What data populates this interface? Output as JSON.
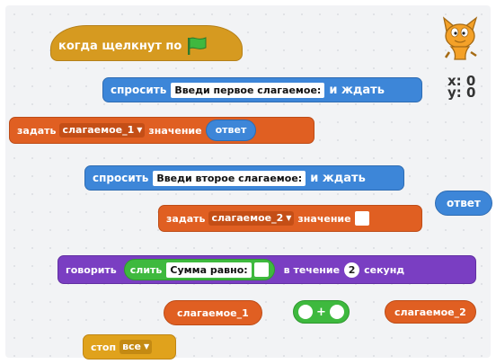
{
  "blocks": {
    "hat": {
      "label": "когда щелкнут по"
    },
    "ask1": {
      "label": "спросить",
      "input": "Введи первое слагаемое:",
      "suffix": "и ждать"
    },
    "set1": {
      "label": "задать",
      "variable": "слагаемое_1",
      "value_label": "значение",
      "reporter": "ответ"
    },
    "ask2": {
      "label": "спросить",
      "input": "Введи второе слагаемое:",
      "suffix": "и ждать"
    },
    "set2": {
      "label": "задать",
      "variable": "слагаемое_2",
      "value_label": "значение"
    },
    "answer": {
      "label": "ответ"
    },
    "say": {
      "label": "говорить",
      "join_label": "слить",
      "join_text": "Сумма равно:",
      "duration_label": "в течение",
      "duration": "2",
      "unit": "секунд"
    },
    "var1": {
      "label": "слагаемое_1"
    },
    "add": {
      "operator": "+"
    },
    "var2": {
      "label": "слагаемое_2"
    },
    "stop": {
      "label": "стоп",
      "option": "все"
    }
  },
  "sprite": {
    "x_label": "x: 0",
    "y_label": "y: 0",
    "icon": "scratch-cat-icon"
  },
  "colors": {
    "events": "#d69a20",
    "sensing": "#3d86d8",
    "data": "#e05f22",
    "looks": "#7a3ec2",
    "operators": "#3eb93e",
    "control": "#e0a21c"
  }
}
